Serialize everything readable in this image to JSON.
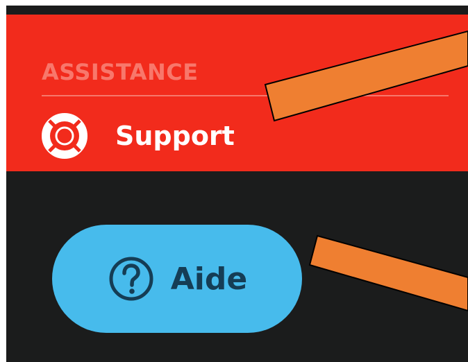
{
  "section": {
    "title": "ASSISTANCE",
    "support": {
      "label": "Support",
      "icon": "lifebuoy-icon"
    }
  },
  "help_button": {
    "label": "Aide",
    "icon": "question-circle-icon"
  },
  "annotations": [
    {
      "name": "annotation-arrow-1",
      "color": "#ef7f31"
    },
    {
      "name": "annotation-arrow-2",
      "color": "#ef7f31"
    }
  ],
  "colors": {
    "section_bg": "#f22b1c",
    "page_bg": "#1b1c1c",
    "button_bg": "#47bbec",
    "button_text": "#153d55"
  }
}
